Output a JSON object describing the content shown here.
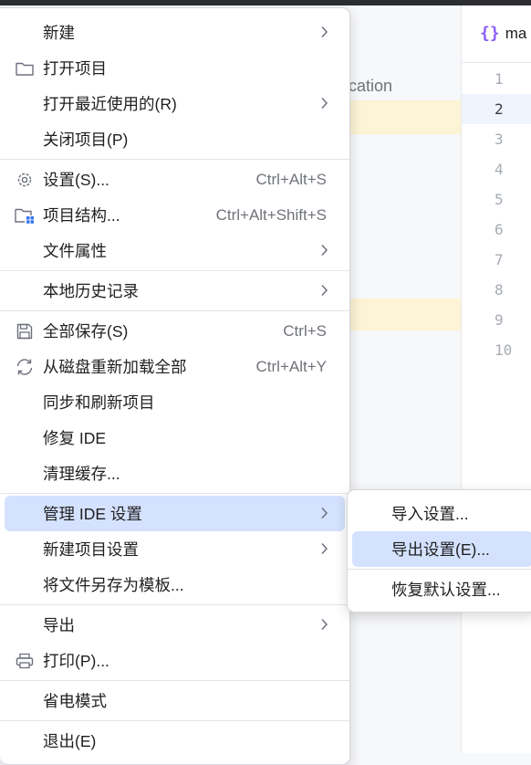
{
  "background": {
    "tree_text": "lication",
    "editor_tab": "ma",
    "line_numbers": [
      "1",
      "2",
      "3",
      "4",
      "5",
      "6",
      "7",
      "8",
      "9",
      "10"
    ],
    "active_line": "2"
  },
  "main_menu": {
    "new": "新建",
    "open_project": "打开项目",
    "open_recent": "打开最近使用的(R)",
    "close_project": "关闭项目(P)",
    "settings": "设置(S)...",
    "settings_shortcut": "Ctrl+Alt+S",
    "project_structure": "项目结构...",
    "project_structure_shortcut": "Ctrl+Alt+Shift+S",
    "file_properties": "文件属性",
    "local_history": "本地历史记录",
    "save_all": "全部保存(S)",
    "save_all_shortcut": "Ctrl+S",
    "reload_from_disk": "从磁盘重新加载全部",
    "reload_shortcut": "Ctrl+Alt+Y",
    "sync_refresh": "同步和刷新项目",
    "repair_ide": "修复 IDE",
    "invalidate_caches": "清理缓存...",
    "manage_ide_settings": "管理 IDE 设置",
    "new_project_settings": "新建项目设置",
    "save_as_template": "将文件另存为模板...",
    "export": "导出",
    "print": "打印(P)...",
    "power_save": "省电模式",
    "exit": "退出(E)"
  },
  "sub_menu": {
    "import_settings": "导入设置...",
    "export_settings": "导出设置(E)...",
    "restore_defaults": "恢复默认设置..."
  },
  "colors": {
    "selection": "#d4e2ff",
    "highlight": "#fdf3d5",
    "file_icon": "#8b5cf6",
    "project_structure_badge": "#3574f0"
  }
}
